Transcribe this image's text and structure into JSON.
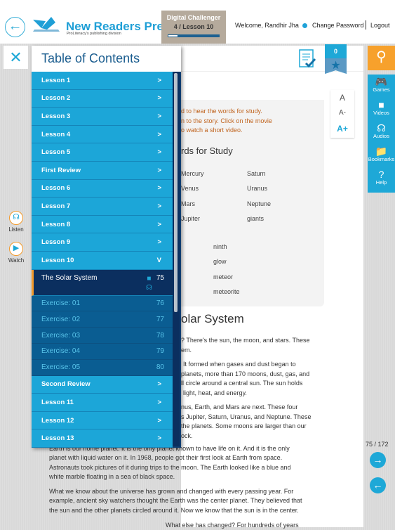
{
  "header": {
    "logo_name": "New Readers Press",
    "logo_sub": "ProLiteracy's publishing division",
    "course": "Digital Challenger",
    "lesson": "4 / Lesson 10",
    "progress": 0.2,
    "welcome": "Welcome, Randhir Jha",
    "change_password": "Change Password",
    "logout": "Logout"
  },
  "bookmark": {
    "count": "0"
  },
  "toc": {
    "title": "Table of Contents",
    "items": [
      {
        "label": "Lesson 1",
        "mark": ">"
      },
      {
        "label": "Lesson 2",
        "mark": ">"
      },
      {
        "label": "Lesson 3",
        "mark": ">"
      },
      {
        "label": "Lesson 4",
        "mark": ">"
      },
      {
        "label": "Lesson 5",
        "mark": ">"
      },
      {
        "label": "First Review",
        "mark": ">"
      },
      {
        "label": "Lesson 6",
        "mark": ">"
      },
      {
        "label": "Lesson 7",
        "mark": ">"
      },
      {
        "label": "Lesson 8",
        "mark": ">"
      },
      {
        "label": "Lesson 9",
        "mark": ">"
      },
      {
        "label": "Lesson 10",
        "mark": "V"
      }
    ],
    "current": {
      "label": "The Solar System",
      "page": "75"
    },
    "exercises": [
      {
        "label": "Exercise: 01",
        "page": "76"
      },
      {
        "label": "Exercise: 02",
        "page": "77"
      },
      {
        "label": "Exercise: 03",
        "page": "78"
      },
      {
        "label": "Exercise: 04",
        "page": "79"
      },
      {
        "label": "Exercise: 05",
        "page": "80"
      }
    ],
    "after": [
      {
        "label": "Second Review",
        "mark": ">"
      },
      {
        "label": "Lesson 11",
        "mark": ">"
      },
      {
        "label": "Lesson 12",
        "mark": ">"
      },
      {
        "label": "Lesson 13",
        "mark": ">"
      }
    ]
  },
  "page": {
    "instructions": [
      "d to hear the words for study.",
      "n to the story. Click on the movie",
      "o watch a short video."
    ],
    "words_heading": "rds for Study",
    "words_col1": [
      "Mercury",
      "Venus",
      "Mars",
      "Jupiter"
    ],
    "words_col2": [
      "Saturn",
      "Uranus",
      "Neptune",
      "giants"
    ],
    "words_col3": [
      "ninth",
      "glow",
      "meteor",
      "meteorite"
    ],
    "title": "olar System",
    "frag": [
      "? There's the sun, the moon, and stars. These",
      "em.",
      "It formed when gases and dust began to",
      "planets, more than 170 moons, dust, gas, and",
      "ll circle around a central sun. The sun holds",
      "light, heat, and energy.",
      "nus, Earth, and Mars are next. These four",
      "s Jupiter, Saturn, Uranus, and Neptune. These",
      "the planets. Some moons are larger than our",
      "ock."
    ],
    "para_earth": [
      "Earth is our home planet. It is the only planet known to have life on it. And it is the only",
      "planet with liquid water on it. In 1968, people got their first look at Earth from space.",
      "Astronauts took pictures of it during trips to the moon. The Earth looked like a blue and",
      "white marble floating in a sea of black space."
    ],
    "para_know": [
      "What we know about the universe has grown and changed with every passing year. For",
      "example, ancient sky watchers thought the Earth was the center planet. They believed that",
      "the sun and the other planets circled around it. Now we know that the sun is in the center."
    ],
    "para_last": "What else has changed? For hundreds of years"
  },
  "font_controls": [
    "A",
    "A-",
    "A+"
  ],
  "sidebar": [
    {
      "label": "Games",
      "icon": "gamepad-icon"
    },
    {
      "label": "Videos",
      "icon": "video-icon"
    },
    {
      "label": "Audios",
      "icon": "headphones-icon"
    },
    {
      "label": "Bookmarks",
      "icon": "bookmark-folder-icon"
    },
    {
      "label": "Help",
      "icon": "help-icon"
    }
  ],
  "left_tools": {
    "listen": "Listen",
    "watch": "Watch"
  },
  "page_number": "75 / 172",
  "colors": {
    "accent": "#1ea8d7",
    "orange": "#f7a12c",
    "toc_dark": "#0b2f5f"
  }
}
